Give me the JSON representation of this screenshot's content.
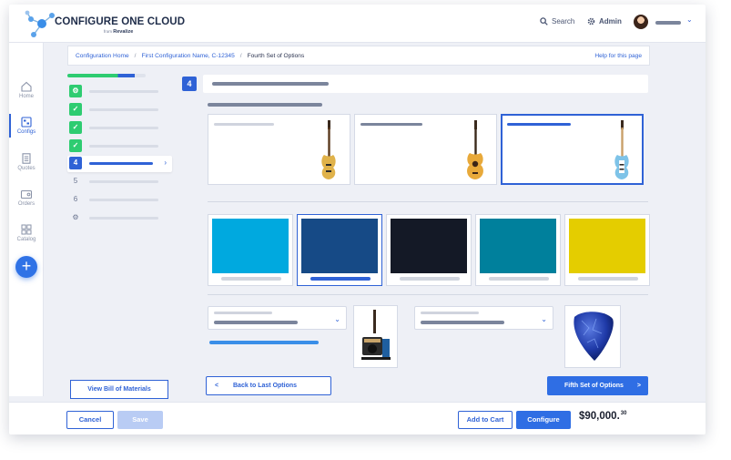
{
  "brand": {
    "name": "CONFIGURE ONE CLOUD",
    "sub_prefix": "from",
    "sub_company": "Revalize"
  },
  "header": {
    "search_label": "Search",
    "admin_label": "Admin"
  },
  "nav": {
    "items": [
      {
        "label": "Home",
        "icon": "home-icon"
      },
      {
        "label": "Configs",
        "icon": "config-icon",
        "active": true
      },
      {
        "label": "Quotes",
        "icon": "quote-icon"
      },
      {
        "label": "Orders",
        "icon": "order-icon"
      },
      {
        "label": "Catalog",
        "icon": "catalog-icon"
      }
    ],
    "add_label": "+"
  },
  "breadcrumb": {
    "items": [
      "Configuration Home",
      "First Configuration Name, C-12345"
    ],
    "current": "Fourth Set of Options",
    "help": "Help for this page"
  },
  "steps": {
    "progress": 0.86,
    "progress_colors": [
      "#2ecc71",
      "#2f62d6"
    ],
    "items": [
      {
        "status": "done",
        "badge": "⚙"
      },
      {
        "status": "done",
        "badge": "✓"
      },
      {
        "status": "done",
        "badge": "✓"
      },
      {
        "status": "done",
        "badge": "✓"
      },
      {
        "status": "current",
        "badge": "4"
      },
      {
        "status": "pending",
        "badge": "5"
      },
      {
        "status": "pending",
        "badge": "6"
      },
      {
        "status": "pending",
        "badge": "⚙"
      }
    ]
  },
  "page": {
    "step_number": "4"
  },
  "swatches": [
    {
      "color": "#00a9df"
    },
    {
      "color": "#164a86",
      "selected": true
    },
    {
      "color": "#141926"
    },
    {
      "color": "#00809c"
    },
    {
      "color": "#e4cd00"
    }
  ],
  "buttons": {
    "bom": "View Bill of Materials",
    "back": "Back to Last Options",
    "back_arrow": "<",
    "next": "Fifth Set of Options",
    "next_arrow": ">",
    "cancel": "Cancel",
    "save": "Save",
    "add_to_cart": "Add to Cart",
    "configure": "Configure"
  },
  "price": {
    "main": "$90,000.",
    "cents": "30"
  }
}
